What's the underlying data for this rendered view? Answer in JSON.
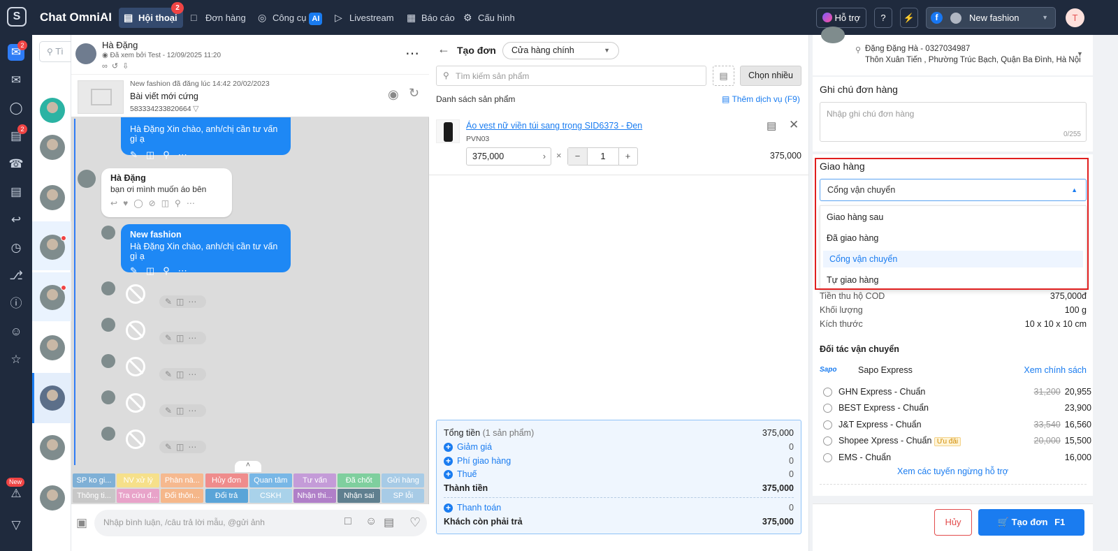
{
  "topbar": {
    "brand": "Chat OmniAI",
    "nav": [
      {
        "label": "Hội thoại",
        "badge": "2"
      },
      {
        "label": "Đơn hàng"
      },
      {
        "label": "Công cụ",
        "chip": "AI"
      },
      {
        "label": "Livestream"
      },
      {
        "label": "Báo cáo"
      },
      {
        "label": "Cấu hình"
      }
    ],
    "support": "Hỗ trợ",
    "shop": "New fashion",
    "user_initial": "T"
  },
  "rail": {
    "inbox_badge": "2",
    "chat_badge": "2",
    "new_badge": "New"
  },
  "conv_list": {
    "search_placeholder": "Tì"
  },
  "chat": {
    "customer_name": "Hà Đặng",
    "seen": "Đã xem bởi Test - 12/09/2025 11:20",
    "post": {
      "posted": "New fashion đã đăng lúc 14:42 20/02/2023",
      "title": "Bài viết mới cứng",
      "id": "583334233820664"
    },
    "messages": [
      {
        "sender": "New fashion",
        "text": "Hà Đặng Xin chào, anh/chị cần tư vấn gì ạ"
      },
      {
        "sender": "Hà Đặng",
        "text": "bạn ơi mình muốn áo bên"
      },
      {
        "sender": "New fashion",
        "text": "Hà Đặng Xin chào, anh/chị cần tư vấn gì ạ"
      }
    ],
    "tags_row1": [
      {
        "label": "SP ko gi...",
        "color": "#7fb0d6"
      },
      {
        "label": "NV xử lý",
        "color": "#f6e08a"
      },
      {
        "label": "Phàn nà...",
        "color": "#f6b98f"
      },
      {
        "label": "Hủy đơn",
        "color": "#ef8c8c"
      },
      {
        "label": "Quan tâm",
        "color": "#78b7e6"
      },
      {
        "label": "Tư vấn",
        "color": "#c49bd8"
      },
      {
        "label": "Đã chốt",
        "color": "#7fcf9e"
      },
      {
        "label": "Gửi hàng",
        "color": "#a7cbe6"
      }
    ],
    "tags_row2": [
      {
        "label": "Thông ti...",
        "color": "#c7c7c7"
      },
      {
        "label": "Tra cứu đ...",
        "color": "#e8a3c9"
      },
      {
        "label": "Đổi thôn...",
        "color": "#f5b78a"
      },
      {
        "label": "Đổi trả",
        "color": "#5aa4d8"
      },
      {
        "label": "CSKH",
        "color": "#a9d2ea"
      },
      {
        "label": "Nhận thi...",
        "color": "#b07fc8"
      },
      {
        "label": "Nhận sai",
        "color": "#5f7f8f"
      },
      {
        "label": "SP lỗi",
        "color": "#a7cbe6"
      }
    ],
    "compose_placeholder": "Nhập bình luận, /câu trả lời mẫu, @gửi ảnh"
  },
  "order": {
    "title": "Tạo đơn",
    "store": "Cửa hàng chính",
    "search_placeholder": "Tìm kiếm sản phẩm",
    "choose_many": "Chọn nhiều",
    "list_label": "Danh sách sản phẩm",
    "add_service": "Thêm dịch vụ (F9)",
    "product": {
      "name": "Áo vest nữ viền túi sang trọng SID6373 - Đen",
      "sku": "PVN03",
      "price": "375,000",
      "qty": "1",
      "total": "375,000"
    },
    "summary": {
      "total_label": "Tổng tiền",
      "total_count": "(1 sản phẩm)",
      "total": "375,000",
      "discount_label": "Giảm giá",
      "discount": "0",
      "ship_label": "Phí giao hàng",
      "ship": "0",
      "tax_label": "Thuế",
      "tax": "0",
      "subtotal_label": "Thành tiền",
      "subtotal": "375,000",
      "pay_label": "Thanh toán",
      "pay": "0",
      "due_label": "Khách còn phải trả",
      "due": "375,000"
    }
  },
  "panel": {
    "address_line1": "Đặng Đặng Hà - 0327034987",
    "address_line2": "Thôn Xuân Tiến , Phường Trúc Bạch, Quận Ba Đình, Hà Nội",
    "note_title": "Ghi chú đơn hàng",
    "note_placeholder": "Nhập ghi chú đơn hàng",
    "note_count": "0/255",
    "delivery_title": "Giao hàng",
    "delivery_selected": "Cổng vận chuyển",
    "delivery_options": [
      "Giao hàng sau",
      "Đã giao hàng",
      "Cổng vận chuyển",
      "Tự giao hàng"
    ],
    "cod_label": "Tiền thu hộ COD",
    "cod": "375,000đ",
    "weight_label": "Khối lượng",
    "weight": "100 g",
    "size_label": "Kích thước",
    "size": "10 x 10 x 10 cm",
    "partner_title": "Đối tác vận chuyển",
    "partner_name": "Sapo Express",
    "partner_link": "Xem chính sách",
    "carriers": [
      {
        "name": "GHN Express - Chuẩn",
        "old": "31,200",
        "price": "20,955"
      },
      {
        "name": "BEST Express - Chuẩn",
        "old": "",
        "price": "23,900"
      },
      {
        "name": "J&T Express - Chuẩn",
        "old": "33,540",
        "price": "16,560"
      },
      {
        "name": "Shopee Xpress - Chuẩn",
        "old": "20,000",
        "price": "15,500",
        "tag": "Ưu đãi"
      },
      {
        "name": "EMS - Chuẩn",
        "old": "",
        "price": "16,000"
      }
    ],
    "routes_link": "Xem các tuyến ngừng hỗ trợ",
    "cancel": "Hủy",
    "create": "Tạo đơn",
    "create_key": "F1"
  }
}
